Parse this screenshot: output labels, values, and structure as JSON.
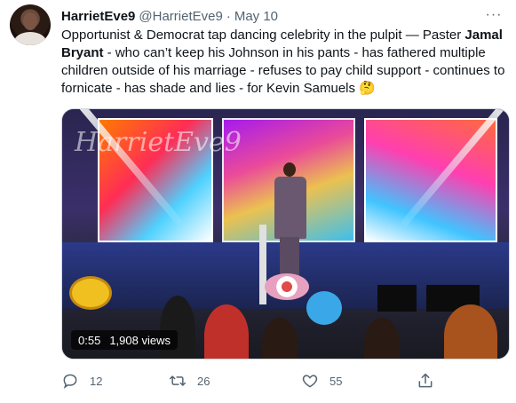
{
  "tweet": {
    "display_name": "HarrietEve9",
    "handle": "@HarrietEve9",
    "separator": "·",
    "date": "May 10",
    "more_label": "···",
    "text_part1": "Opportunist & Democrat tap dancing celebrity in the pulpit — Paster ",
    "text_bold": "Jamal Bryant",
    "text_part2": " - who can’t keep his Johnson in his pants - has fathered multiple children outside of his marriage - refuses to pay child support - continues to fornicate - has shade and lies - for Kevin Samuels 🤔"
  },
  "media": {
    "watermark": "HarrietEve9",
    "duration": "0:55",
    "views": "1,908 views"
  },
  "actions": {
    "reply_count": "12",
    "retweet_count": "26",
    "like_count": "55"
  },
  "icons": {
    "reply": "reply-icon",
    "retweet": "retweet-icon",
    "like": "heart-icon",
    "share": "share-icon",
    "more": "more-icon"
  },
  "colors": {
    "text_primary": "#0f1419",
    "text_secondary": "#536471",
    "border": "#cfd9de"
  }
}
